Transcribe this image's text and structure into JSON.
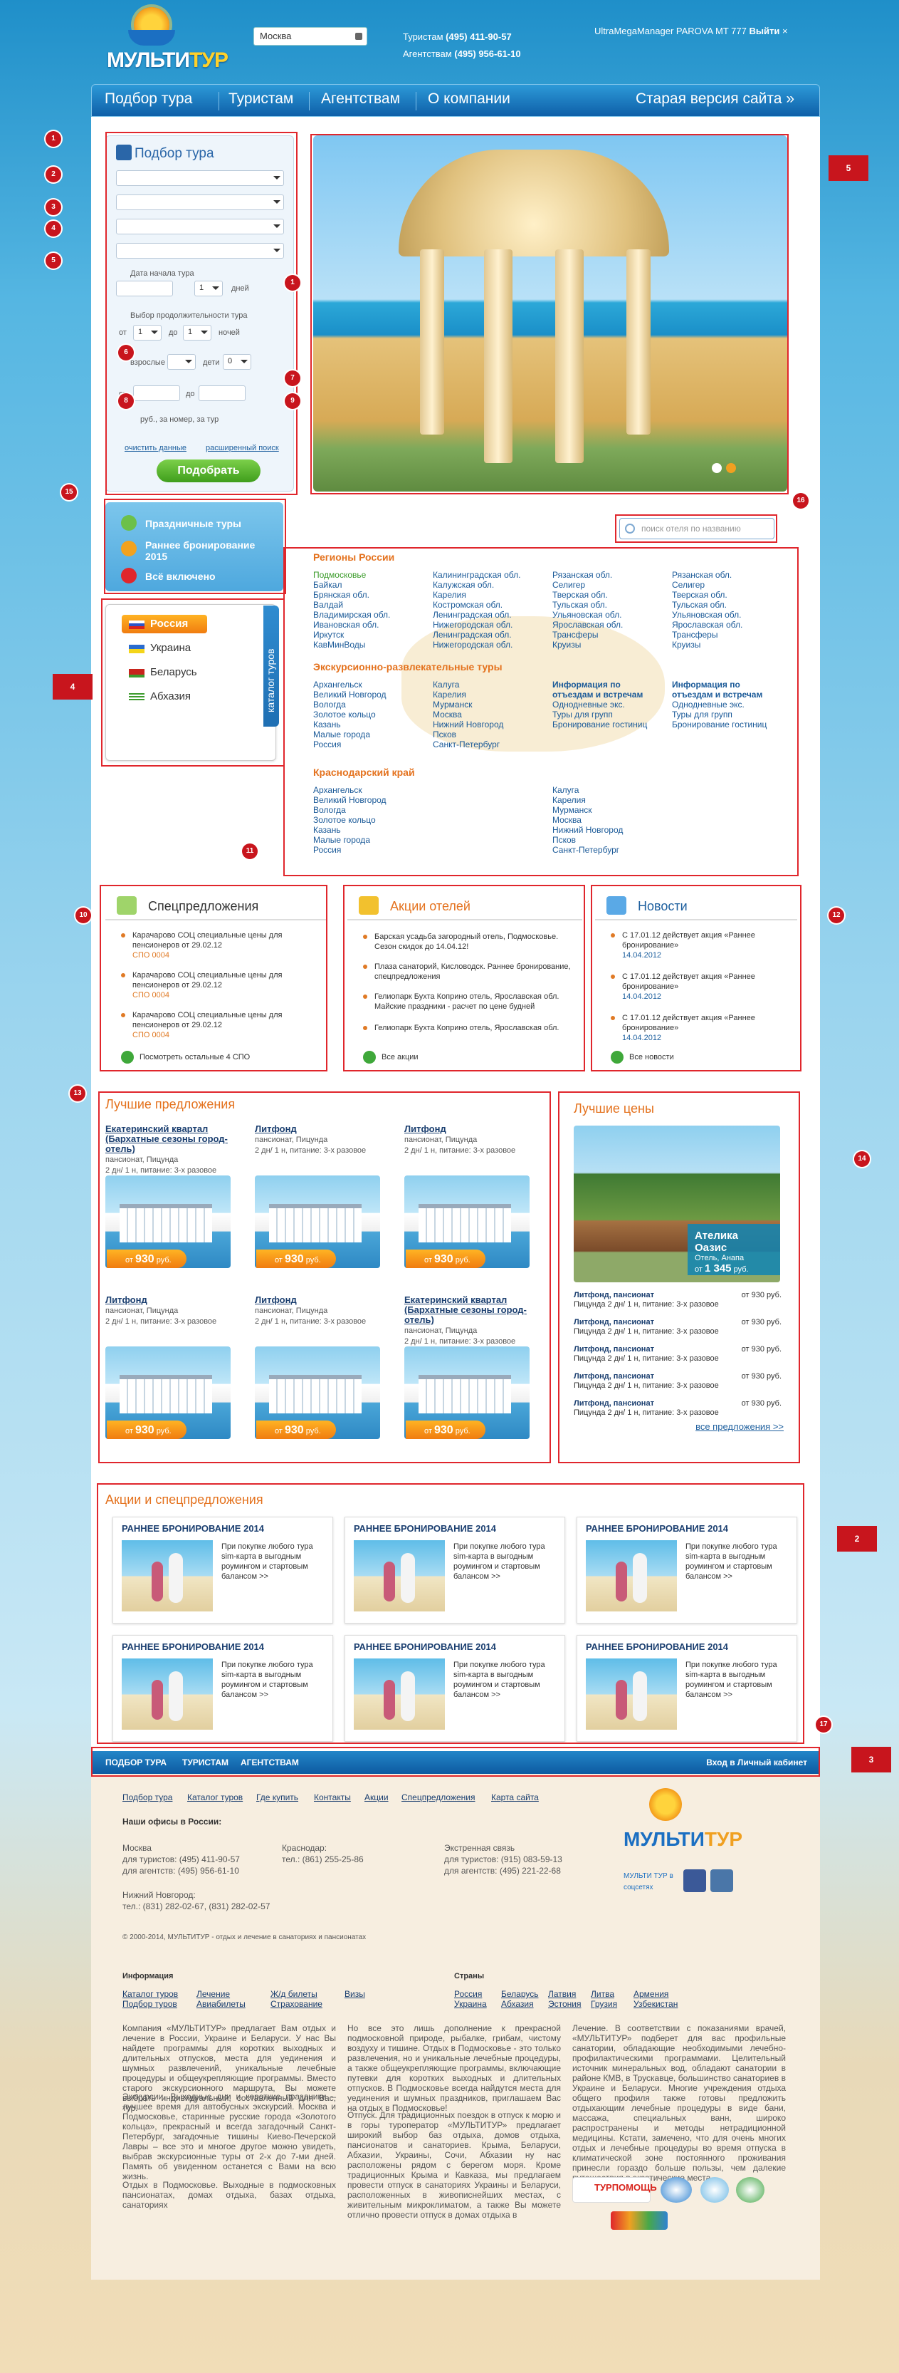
{
  "header": {
    "brand_left": "МУЛЬТИ",
    "brand_right": "ТУР",
    "city": "Москва",
    "phone1_label": "Туристам",
    "phone1": "(495) 411-90-57",
    "phone2_label": "Агентствам",
    "phone2": "(495) 956-61-10",
    "user": "UltraMegaManager PAROVA MT 777",
    "logout": "Выйти"
  },
  "nav": [
    "Подбор тура",
    "Туристам",
    "Агентствам",
    "О компании"
  ],
  "nav_old": "Старая версия сайта »",
  "search": {
    "title": "Подбор тура",
    "date_label": "Дата начала тура",
    "days_val": "1",
    "days": "дней",
    "dur_label": "Выбор продолжительности тура",
    "from": "от",
    "to": "до",
    "nights": "ночей",
    "nights_val": "1",
    "to_val": "1",
    "adults": "взрослые",
    "children": "дети",
    "children_val": "0",
    "price_from": "от",
    "price_to": "до",
    "price_hint": "руб., за номер, за тур",
    "clear": "очистить данные",
    "extended": "расширенный поиск",
    "submit": "Подобрать"
  },
  "quick": [
    "Праздничные туры",
    "Раннее бронирование 2015",
    "Всё включено"
  ],
  "hotel_search": "поиск отеля по названию",
  "catalog_tab": "каталог туров",
  "countries": [
    "Россия",
    "Украина",
    "Беларусь",
    "Абхазия"
  ],
  "regions": {
    "head1": "Регионы России",
    "col1": [
      "Подмосковье",
      "Байкал",
      "Брянская обл.",
      "Валдай",
      "Владимирская обл.",
      "Ивановская обл.",
      "Иркутск",
      "КавМинВоды"
    ],
    "col2": [
      "Калининградская обл.",
      "Калужская обл.",
      "Карелия",
      "Костромская обл.",
      "Ленинградская обл.",
      "Нижегородская обл.",
      "Ленинградская обл.",
      "Нижегородская обл."
    ],
    "col3": [
      "Рязанская обл.",
      "Селигер",
      "Тверская обл.",
      "Тульская обл.",
      "Ульяновская обл.",
      "Ярославская обл.",
      "Трансферы",
      "Круизы"
    ],
    "col4": [
      "Рязанская обл.",
      "Селигер",
      "Тверская обл.",
      "Тульская обл.",
      "Ульяновская обл.",
      "Ярославская обл.",
      "Трансферы",
      "Круизы"
    ],
    "head2": "Экскурсионно-развлекательные туры",
    "ex1": [
      "Архангельск",
      "Великий Новгород",
      "Вологда",
      "Золотое кольцо",
      "Казань",
      "Малые города",
      "Россия"
    ],
    "ex2": [
      "Калуга",
      "Карелия",
      "Мурманск",
      "Москва",
      "Нижний Новгород",
      "Псков",
      "Санкт-Петербург"
    ],
    "ex3_head": "Информация по отъездам и встречам",
    "ex3": [
      "Однодневные экс.",
      "Туры для групп",
      "Бронирование гостиниц"
    ],
    "ex4_head": "Информация по отъездам и встречам",
    "ex4": [
      "Однодневные экс.",
      "Туры для групп",
      "Бронирование гостиниц"
    ],
    "head3": "Краснодарский край",
    "kr1": [
      "Архангельск",
      "Великий Новгород",
      "Вологда",
      "Золотое кольцо",
      "Казань",
      "Малые города",
      "Россия"
    ],
    "kr2": [
      "Калуга",
      "Карелия",
      "Мурманск",
      "Москва",
      "Нижний Новгород",
      "Псков",
      "Санкт-Петербург"
    ]
  },
  "spo": {
    "title": "Спецпредложения",
    "items": [
      {
        "t": "Карачарово СОЦ специальные цены для пенсионеров от 29.02.12",
        "c": "СПО 0004"
      },
      {
        "t": "Карачарово СОЦ специальные цены для пенсионеров от 29.02.12",
        "c": "СПО 0004"
      },
      {
        "t": "Карачарово СОЦ специальные цены для пенсионеров от 29.02.12",
        "c": "СПО 0004"
      }
    ],
    "more": "Посмотреть остальные 4 СПО"
  },
  "hotels": {
    "title": "Акции отелей",
    "items": [
      "Барская усадьба загородный отель, Подмосковье. Сезон скидок до 14.04.12!",
      "Плаза санаторий, Кисловодск. Раннее бронирование, спецпредложения",
      "Гелиопарк Бухта Коприно отель, Ярославская обл. Майские праздники - расчет по цене будней",
      "Гелиопарк Бухта Коприно отель, Ярославская обл."
    ],
    "more": "Все акции"
  },
  "news": {
    "title": "Новости",
    "items": [
      {
        "t": "С 17.01.12 действует акция «Раннее бронирование»",
        "d": "14.04.2012"
      },
      {
        "t": "С 17.01.12 действует акция «Раннее бронирование»",
        "d": "14.04.2012"
      },
      {
        "t": "С 17.01.12 действует акция «Раннее бронирование»",
        "d": "14.04.2012"
      }
    ],
    "more": "Все новости"
  },
  "best": {
    "title": "Лучшие предложения",
    "cards": [
      {
        "name": "Екатеринский квартал (Бархатные сезоны город-отель)",
        "desc": "пансионат, Пицунда",
        "sub": "2 дн/ 1 н, питание: 3-х разовое",
        "price": "930"
      },
      {
        "name": "Литфонд",
        "desc": "пансионат, Пицунда",
        "sub": "2 дн/ 1 н, питание: 3-х разовое",
        "price": "930"
      },
      {
        "name": "Литфонд",
        "desc": "пансионат, Пицунда",
        "sub": "2 дн/ 1 н, питание: 3-х разовое",
        "price": "930"
      },
      {
        "name": "Литфонд",
        "desc": "пансионат, Пицунда",
        "sub": "2 дн/ 1 н, питание: 3-х разовое",
        "price": "930"
      },
      {
        "name": "Литфонд",
        "desc": "пансионат, Пицунда",
        "sub": "2 дн/ 1 н, питание: 3-х разовое",
        "price": "930"
      },
      {
        "name": "Екатеринский квартал (Бархатные сезоны город-отель)",
        "desc": "пансионат, Пицунда",
        "sub": "2 дн/ 1 н, питание: 3-х разовое",
        "price": "930"
      }
    ],
    "price_prefix": "от",
    "price_suffix": "руб."
  },
  "lowest": {
    "title": "Лучшие цены",
    "hotel": "Ателика Оазис",
    "hotel_sub": "Отель, Анапа",
    "hotel_price": "1 345",
    "rows": [
      {
        "n": "Литфонд, пансионат",
        "s": "Пицунда 2 дн/ 1 н, питание: 3-х разовое",
        "p": "от 930 руб."
      },
      {
        "n": "Литфонд, пансионат",
        "s": "Пицунда 2 дн/ 1 н, питание: 3-х разовое",
        "p": "от 930 руб."
      },
      {
        "n": "Литфонд, пансионат",
        "s": "Пицунда 2 дн/ 1 н, питание: 3-х разовое",
        "p": "от 930 руб."
      },
      {
        "n": "Литфонд, пансионат",
        "s": "Пицунда 2 дн/ 1 н, питание: 3-х разовое",
        "p": "от 930 руб."
      },
      {
        "n": "Литфонд, пансионат",
        "s": "Пицунда 2 дн/ 1 н, питание: 3-х разовое",
        "p": "от 930 руб."
      }
    ],
    "all": "все предложения >>"
  },
  "promos": {
    "title": "Акции и спецпредложения",
    "card_title": "РАННЕЕ БРОНИРОВАНИЕ 2014",
    "card_text": "При покупке любого тура sim-карта в выгодным роумингом и стартовым балансом >>"
  },
  "bottom_nav": [
    "ПОДБОР ТУРА",
    "ТУРИСТАМ",
    "АГЕНТСТВАМ"
  ],
  "cabinet": "Вход в Личный кабинет",
  "footer": {
    "links": [
      "Подбор тура",
      "Каталог туров",
      "Где купить",
      "Контакты",
      "Акции",
      "Спецпредложения",
      "Карта сайта"
    ],
    "offices": "Наши офисы в России:",
    "moscow": "Москва",
    "moscow1": "для туристов: (495) 411-90-57",
    "moscow2": "для агентств: (495) 956-61-10",
    "krd": "Краснодар:",
    "krd1": "тел.: (861) 255-25-86",
    "emerg": "Экстренная связь",
    "emerg1": "для туристов: (915) 083-59-13",
    "emerg2": "для агентств: (495) 221-22-68",
    "nn": "Нижний Новгород:",
    "nn1": "тел.: (831) 282-02-67, (831) 282-02-57",
    "copy": "© 2000-2014, МУЛЬТИТУР - отдых и лечение в санаториях и пансионатах",
    "social": "МУЛЬТИ ТУР в соцсетях",
    "info": "Информация",
    "info_links": [
      "Каталог туров",
      "Лечение",
      "Ж/д билеты",
      "Визы",
      "Подбор туров",
      "Авиабилеты",
      "Страхование"
    ],
    "countries": "Страны",
    "country_links": [
      "Россия",
      "Беларусь",
      "Латвия",
      "Литва",
      "Армения",
      "Украина",
      "Абхазия",
      "Эстония",
      "Грузия",
      "Узбекистан"
    ],
    "p1": "Компания «МУЛЬТИТУР» предлагает Вам отдых и лечение в России, Украине и Беларуси. У нас Вы найдете программы для коротких выходных и длительных отпусков, места для уединения и шумных развлечений, уникальные лечебные процедуры и общеукрепляющие программы. Вместо старого экскурсионного маршрута, Вы можете выбрать индивидуальный, составленный для Вас, тур.",
    "p2": "Экскурсии. Выходные дни и короткие праздники – лучшее время для автобусных экскурсий. Москва и Подмосковье, старинные русские города «Золотого кольца», прекрасный и всегда загадочный Санкт-Петербург, загадочные тишины Киево-Печерской Лавры – все это и многое другое можно увидеть, выбрав экскурсионные туры от 2-х до 7-ми дней. Память об увиденном останется с Вами на всю жизнь.",
    "p3": "Отдых в Подмосковье. Выходные в подмосковных пансионатах, домах отдыха, базах отдыха, санаториях",
    "p4": "Но все это лишь дополнение к прекрасной подмосковной природе, рыбалке, грибам, чистому воздуху и тишине. Отдых в Подмосковье - это только развлечения, но и уникальные лечебные процедуры, а также общеукрепляющие программы, включающие путевки для коротких выходных и длительных отпусков. В Подмосковье всегда найдутся места для уединения и шумных праздников, приглашаем Вас на отдых в Подмосковье!",
    "p5": "Отпуск. Для традиционных поездок в отпуск к морю и в горы туроператор «МУЛЬТИТУР» предлагает широкий выбор баз отдыха, домов отдыха, пансионатов и санаториев. Крыма, Беларуси, Абхазии, Украины, Сочи, Абхазии ну нас расположены рядом с берегом моря. Кроме традиционных Крыма и Кавказа, мы предлагаем провести отпуск в санаториях Украины и Беларуси, расположенных в живописнейших местах, с живительным микроклиматом, а также Вы можете отлично провести отпуск в домах отдыха в",
    "p6": "Лечение. В соответствии с показаниями врачей, «МУЛЬТИТУР» подберет для вас профильные санатории, обладающие необходимыми лечебно-профилактическими программами. Целительный источник минеральных вод, обладают санатории в районе КМВ, в Трускавце, большинство санаториев в Украине и Беларуси. Многие учреждения отдыха общего профиля также готовы предложить отдыхающим лечебные процедуры в виде бани, массажа, специальных ванн, широко распространены и методы нетрадиционной медицины. Кстати, замечено, что для очень многих отдых и лечебные процедуры во время отпуска в климатической зоне постоянного проживания принесли гораздо больше пользы, чем далекие путешествия в экзотические места.",
    "partner1": "ТУРПОМОЩЬ",
    "partner1_sub": "TOURPOM.RU"
  },
  "annotations": [
    "1",
    "2",
    "3",
    "4",
    "5",
    "6",
    "7",
    "8",
    "9",
    "1",
    "11",
    "12",
    "13",
    "14",
    "15",
    "16",
    "17",
    "4",
    "5",
    "2",
    "3",
    "10"
  ]
}
